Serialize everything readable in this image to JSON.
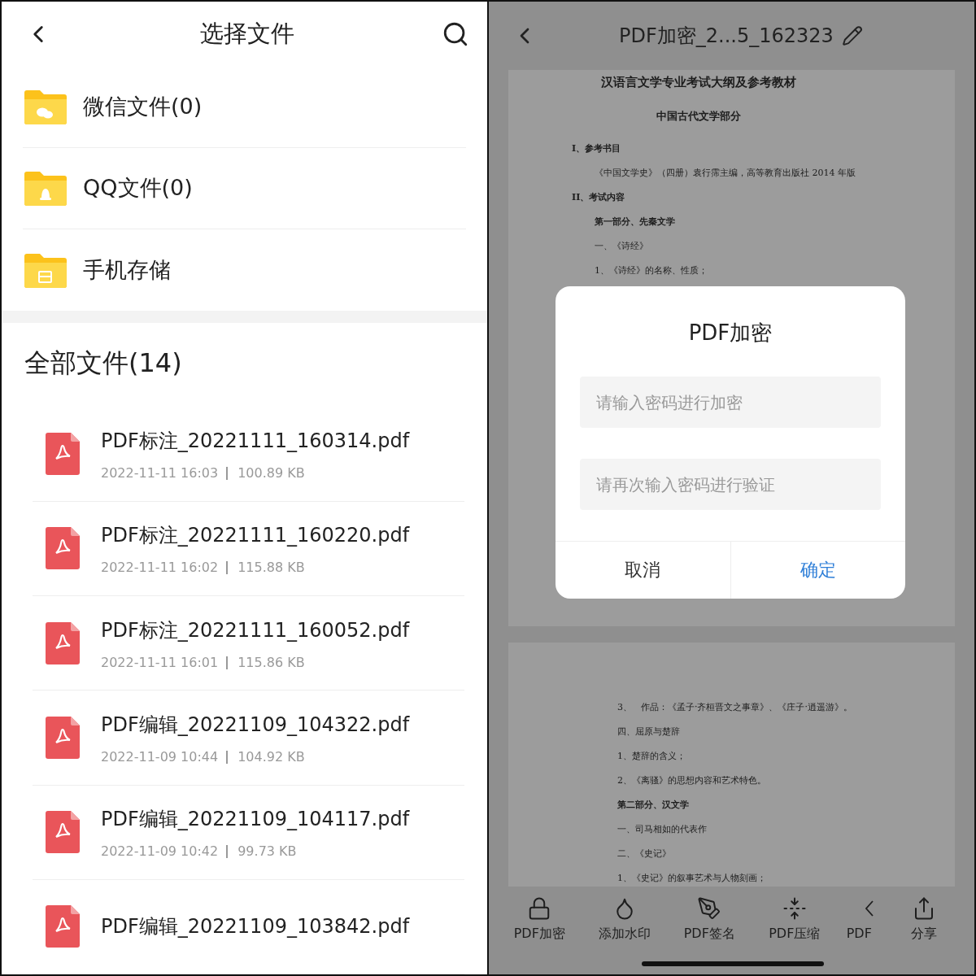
{
  "file_picker": {
    "title": "选择文件",
    "folders": [
      {
        "kind": "wechat",
        "label": "微信文件(0)"
      },
      {
        "kind": "qq",
        "label": "QQ文件(0)"
      },
      {
        "kind": "storage",
        "label": "手机存储"
      }
    ],
    "section_title": "全部文件(14)",
    "files": [
      {
        "name": "PDF标注_20221111_160314.pdf",
        "date": "2022-11-11 16:03",
        "size": "100.89 KB"
      },
      {
        "name": "PDF标注_20221111_160220.pdf",
        "date": "2022-11-11 16:02",
        "size": "115.88 KB"
      },
      {
        "name": "PDF标注_20221111_160052.pdf",
        "date": "2022-11-11 16:01",
        "size": "115.86 KB"
      },
      {
        "name": "PDF编辑_20221109_104322.pdf",
        "date": "2022-11-09 10:44",
        "size": "104.92 KB"
      },
      {
        "name": "PDF编辑_20221109_104117.pdf",
        "date": "2022-11-09 10:42",
        "size": "99.73 KB"
      },
      {
        "name": "PDF编辑_20221109_103842.pdf"
      }
    ]
  },
  "viewer": {
    "title": "PDF加密_2...5_162323",
    "pages": [
      {
        "lines": [
          {
            "kind": "title",
            "text": "汉语言文学专业考试大纲及参考教材"
          },
          {
            "kind": "subtitle",
            "text": "中国古代文学部分"
          },
          {
            "kind": "section",
            "text": "I、参考书目"
          },
          {
            "kind": "item",
            "text": "《中国文学史》（四册）袁行霈主编，高等教育出版社 2014 年版"
          },
          {
            "kind": "section",
            "text": "II、考试内容"
          },
          {
            "kind": "bold",
            "text": "第一部分、先秦文学"
          },
          {
            "kind": "item",
            "text": "一、《诗经》"
          },
          {
            "kind": "item",
            "text": "1、《诗经》的名称、性质；"
          }
        ]
      },
      {
        "lines": [
          {
            "kind": "item",
            "text": "3、　作品：《孟子·齐桓晋文之事章》、《庄子·逍遥游》。"
          },
          {
            "kind": "item",
            "text": "四、屈原与楚辞"
          },
          {
            "kind": "item",
            "text": "1、楚辞的含义；"
          },
          {
            "kind": "item",
            "text": "2、《离骚》的思想内容和艺术特色。"
          },
          {
            "kind": "bold",
            "text": "第二部分、汉文学"
          },
          {
            "kind": "item",
            "text": "一、司马相如的代表作"
          },
          {
            "kind": "item",
            "text": "二、《史记》"
          },
          {
            "kind": "item",
            "text": "1、《史记》的叙事艺术与人物刻画；"
          }
        ]
      }
    ],
    "tools": [
      {
        "kind": "lock",
        "label": "PDF加密"
      },
      {
        "kind": "drop",
        "label": "添加水印"
      },
      {
        "kind": "pen",
        "label": "PDF签名"
      },
      {
        "kind": "compress",
        "label": "PDF压缩"
      },
      {
        "kind": "partial",
        "label": "PDF"
      },
      {
        "kind": "share",
        "label": "分享"
      }
    ],
    "dialog": {
      "title": "PDF加密",
      "fields": [
        {
          "placeholder": "请输入密码进行加密"
        },
        {
          "placeholder": "请再次输入密码进行验证"
        }
      ],
      "buttons": [
        {
          "kind": "cancel",
          "label": "取消"
        },
        {
          "kind": "confirm",
          "label": "确定"
        }
      ]
    }
  }
}
